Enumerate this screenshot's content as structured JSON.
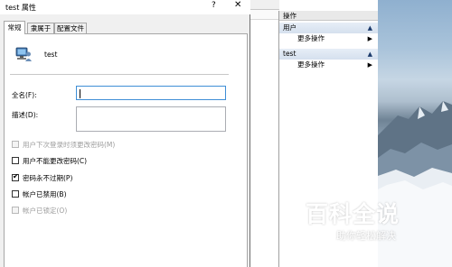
{
  "dialog": {
    "title": "test 属性",
    "help_glyph": "?",
    "close_glyph": "✕",
    "tabs": [
      {
        "label": "常规"
      },
      {
        "label": "隶属于"
      },
      {
        "label": "配置文件"
      }
    ],
    "user_name": "test",
    "fields": {
      "full_name_label": "全名(F):",
      "full_name_value": "",
      "description_label": "描述(D):",
      "description_value": ""
    },
    "checkboxes": [
      {
        "label": "用户下次登录时须更改密码(M)",
        "checked": false,
        "enabled": false
      },
      {
        "label": "用户不能更改密码(C)",
        "checked": false,
        "enabled": true
      },
      {
        "label": "密码永不过期(P)",
        "checked": true,
        "enabled": true
      },
      {
        "label": "帐户已禁用(B)",
        "checked": false,
        "enabled": true
      },
      {
        "label": "帐户已锁定(O)",
        "checked": false,
        "enabled": false
      }
    ],
    "check_glyph": "✔"
  },
  "actions_pane": {
    "title": "操作",
    "groups": [
      {
        "label": "用户",
        "item": "更多操作"
      },
      {
        "label": "test",
        "item": "更多操作"
      }
    ],
    "collapse_glyph": "▲",
    "submenu_glyph": "▶"
  },
  "watermark": {
    "title": "百科全说",
    "subtitle": "助你轻松解决"
  },
  "colors": {
    "focus_border": "#3e8ed6",
    "action_group_bg": "#d5e0ee"
  }
}
